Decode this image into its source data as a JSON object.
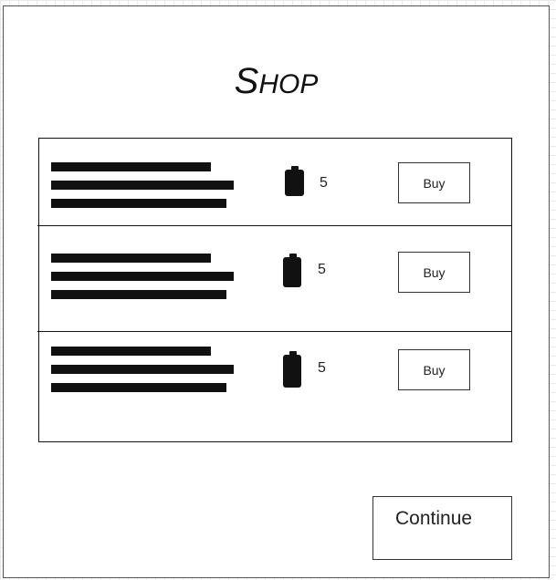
{
  "title": {
    "first": "S",
    "rest": "hop"
  },
  "items": [
    {
      "count": "5",
      "buy_label": "Buy",
      "icon": "battery-icon"
    },
    {
      "count": "5",
      "buy_label": "Buy",
      "icon": "battery-icon"
    },
    {
      "count": "5",
      "buy_label": "Buy",
      "icon": "battery-icon"
    }
  ],
  "continue_label": "Continue"
}
